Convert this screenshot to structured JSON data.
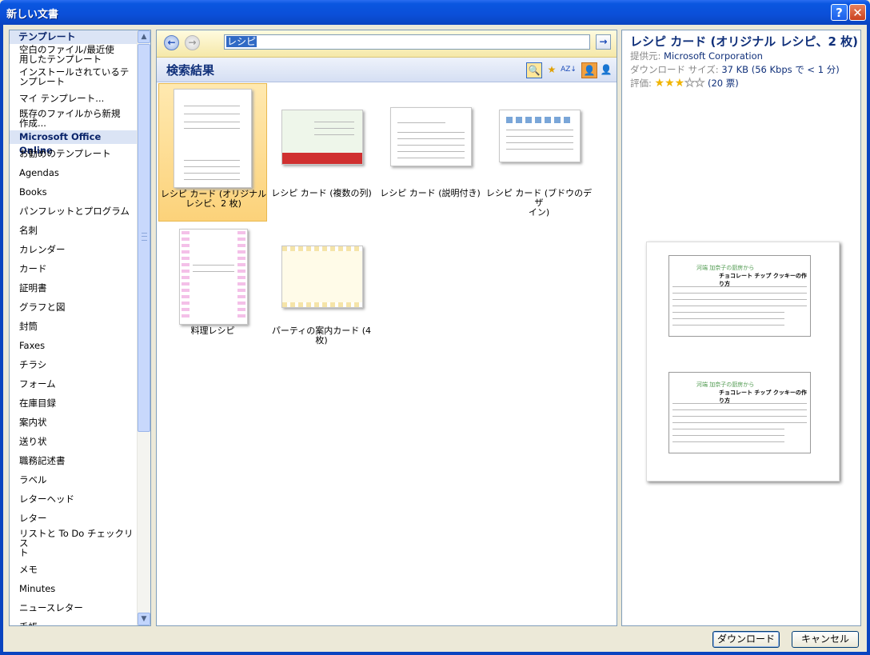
{
  "window": {
    "title": "新しい文書"
  },
  "left": {
    "header": "テンプレート",
    "items": [
      "空白のファイル/最近使\n用したテンプレート",
      "インストールされているテ\nンプレート",
      "マイ テンプレート...",
      "既存のファイルから新規\n作成...",
      "Microsoft Office Online",
      "お勧めのテンプレート",
      "Agendas",
      "Books",
      "パンフレットとプログラム",
      "名刺",
      "カレンダー",
      "カード",
      "証明書",
      "グラフと図",
      "封筒",
      "Faxes",
      "チラシ",
      "フォーム",
      "在庫目録",
      "案内状",
      "送り状",
      "職務記述書",
      "ラベル",
      "レターヘッド",
      "レター",
      "リストと To Do チェックリス\nト",
      "メモ",
      "Minutes",
      "ニュースレター",
      "手帳"
    ]
  },
  "search": {
    "value": "レシピ"
  },
  "results": {
    "label": "検索結果",
    "items": [
      {
        "caption": "レシピ カード (オリジナル\nレシピ、2 枚)"
      },
      {
        "caption": "レシピ カード (複数の列)"
      },
      {
        "caption": "レシピ カード (説明付き)"
      },
      {
        "caption": "レシピ カード (ブドウのデザ\nイン)"
      },
      {
        "caption": "料理レシピ"
      },
      {
        "caption": "パーティの案内カード (4\n枚)"
      }
    ]
  },
  "detail": {
    "title": "レシピ カード (オリジナル レシピ、2 枚)",
    "provider_key": "提供元:",
    "provider_val": "Microsoft Corporation",
    "size_key": "ダウンロード サイズ:",
    "size_val": "37 KB (56 Kbps で < 1 分)",
    "rating_key": "評価:",
    "rating": 3,
    "votes": "(20 票)",
    "card_line1": "河端 加奈子の厨房から",
    "card_line2": "チョコレート チップ クッキーの作り方"
  },
  "buttons": {
    "download": "ダウンロード",
    "cancel": "キャンセル"
  },
  "colors": {
    "titlebar": "#0a4fd8",
    "selected_tile": "#fcd27a",
    "accent": "#10307a"
  }
}
